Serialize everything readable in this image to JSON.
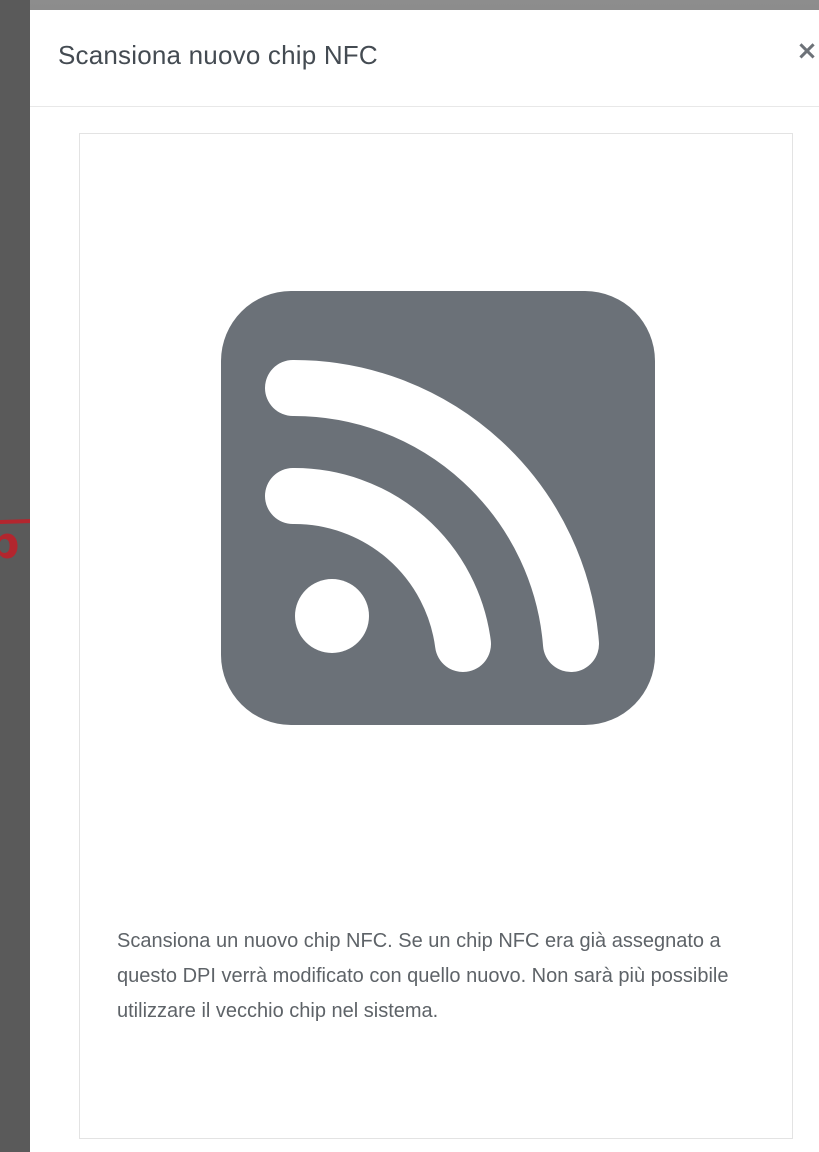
{
  "annotation": {
    "letter": "p",
    "color": "#b3262e"
  },
  "modal": {
    "title": "Scansiona nuovo chip NFC",
    "close_label": "×",
    "icon": "nfc-rss-icon",
    "icon_color": "#6b7178",
    "description": "Scansiona un nuovo chip NFC. Se un chip NFC era già assegnato a questo DPI verrà modificato con quello nuovo. Non sarà più possibile utilizzare il vecchio chip nel sistema."
  }
}
